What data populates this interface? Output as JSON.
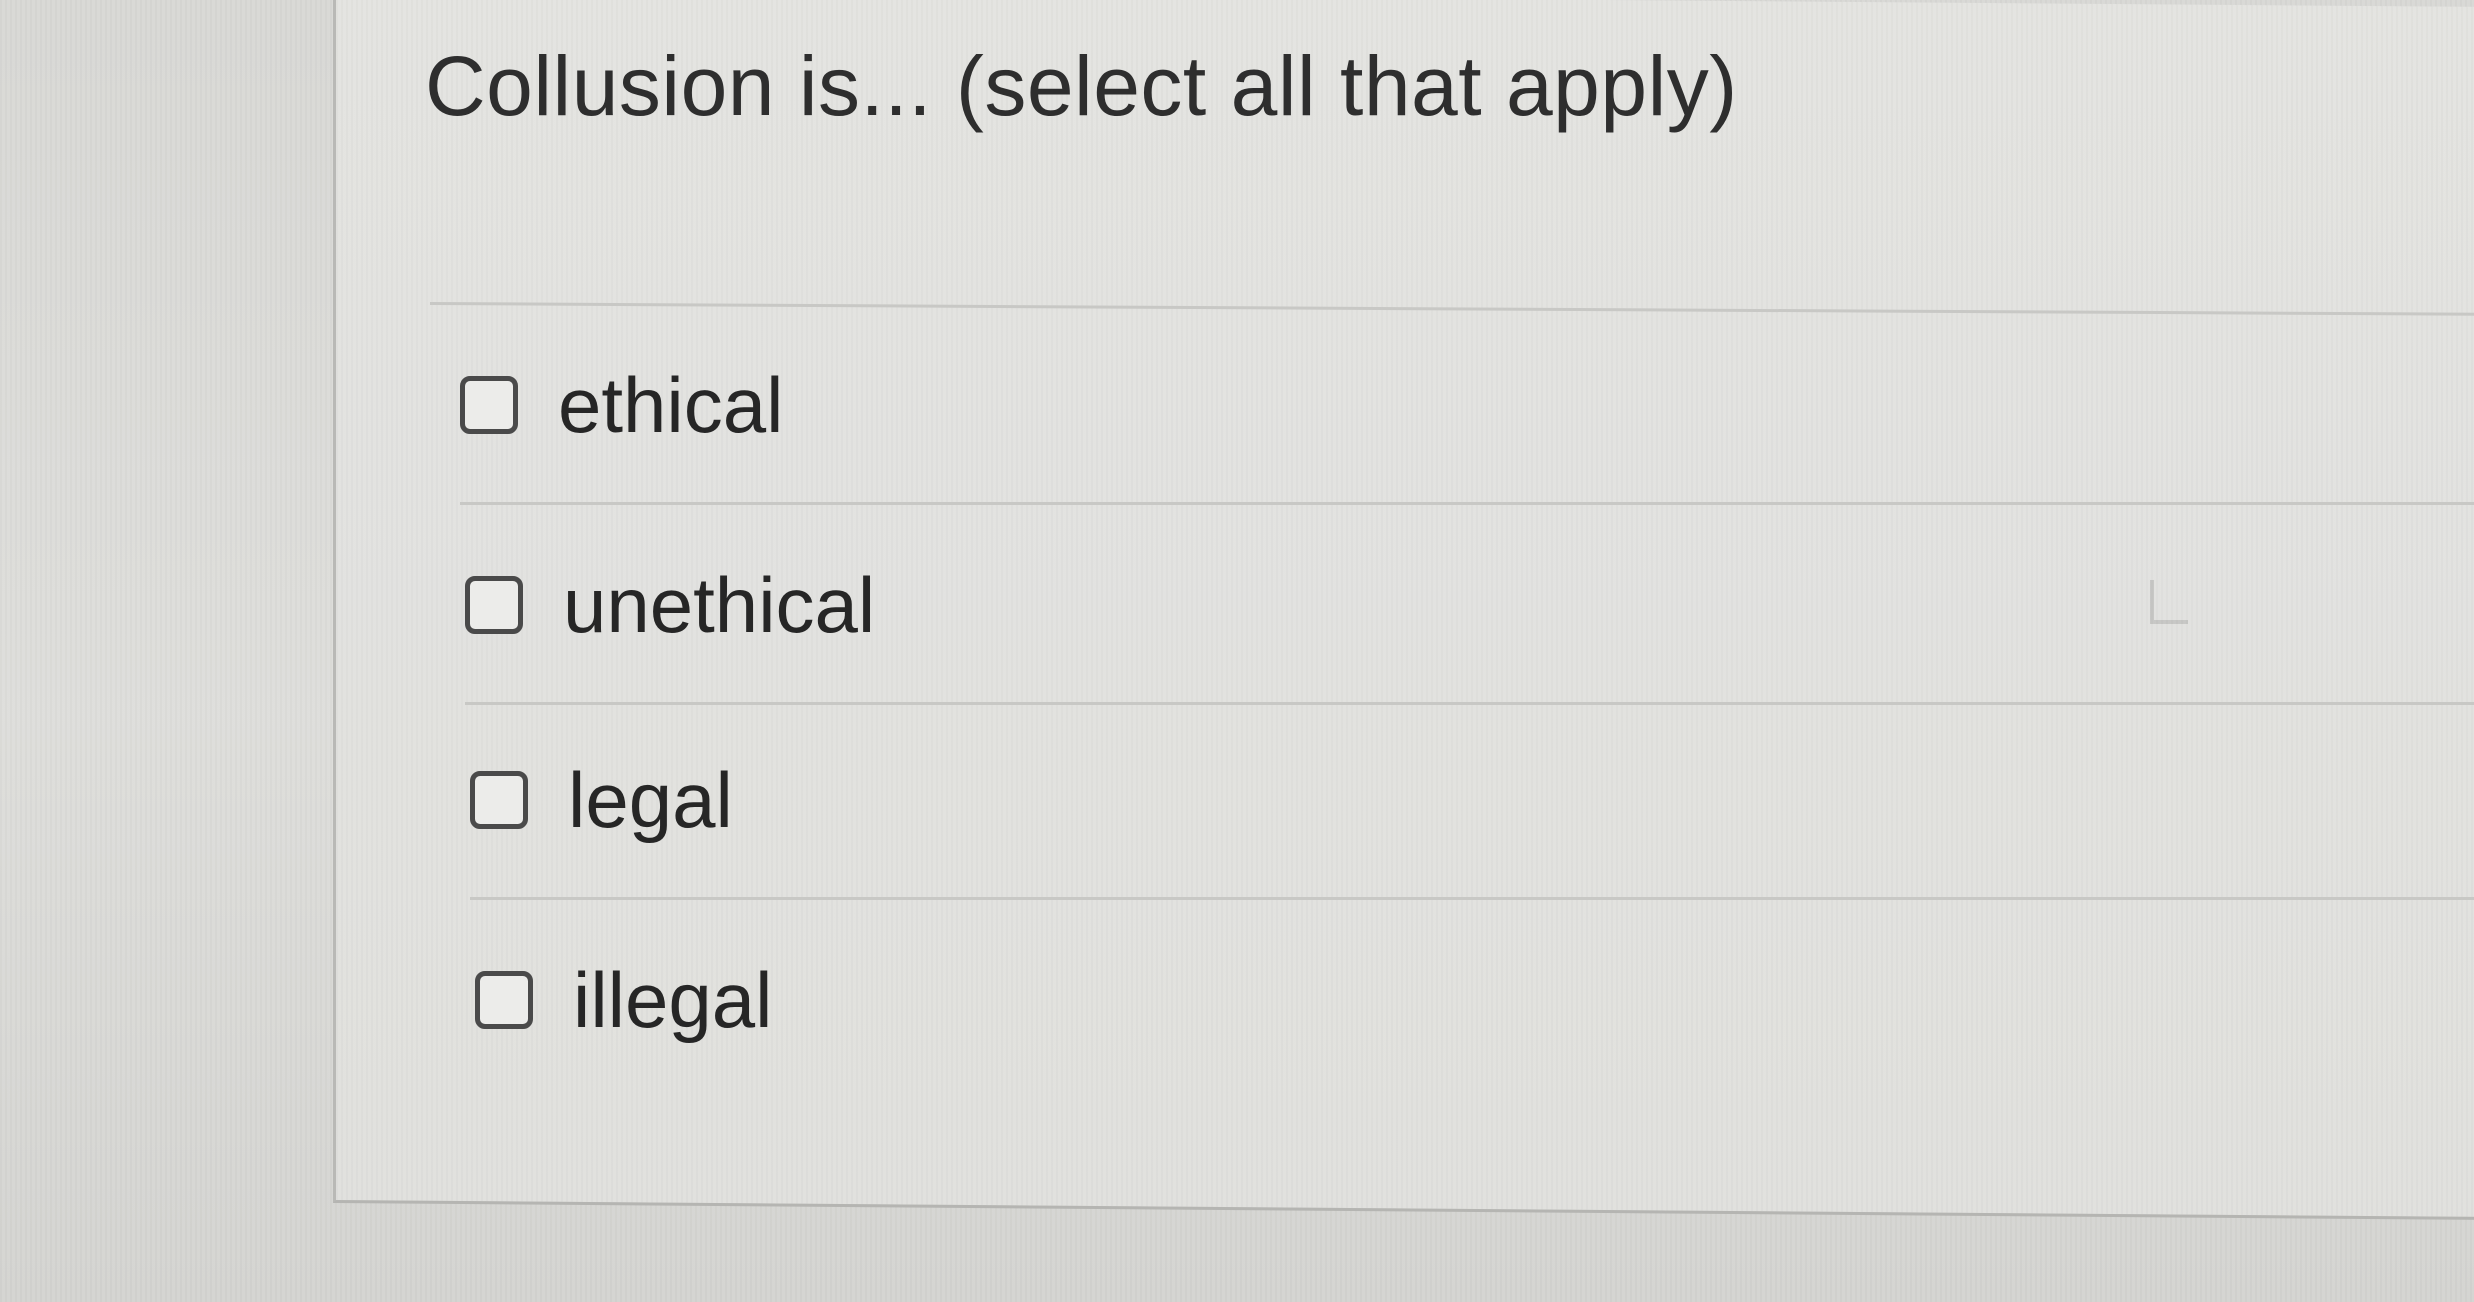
{
  "question": {
    "text": "Collusion is... (select all that apply)"
  },
  "answers": [
    {
      "label": "ethical",
      "checked": false
    },
    {
      "label": "unethical",
      "checked": false
    },
    {
      "label": "legal",
      "checked": false
    },
    {
      "label": "illegal",
      "checked": false
    }
  ]
}
